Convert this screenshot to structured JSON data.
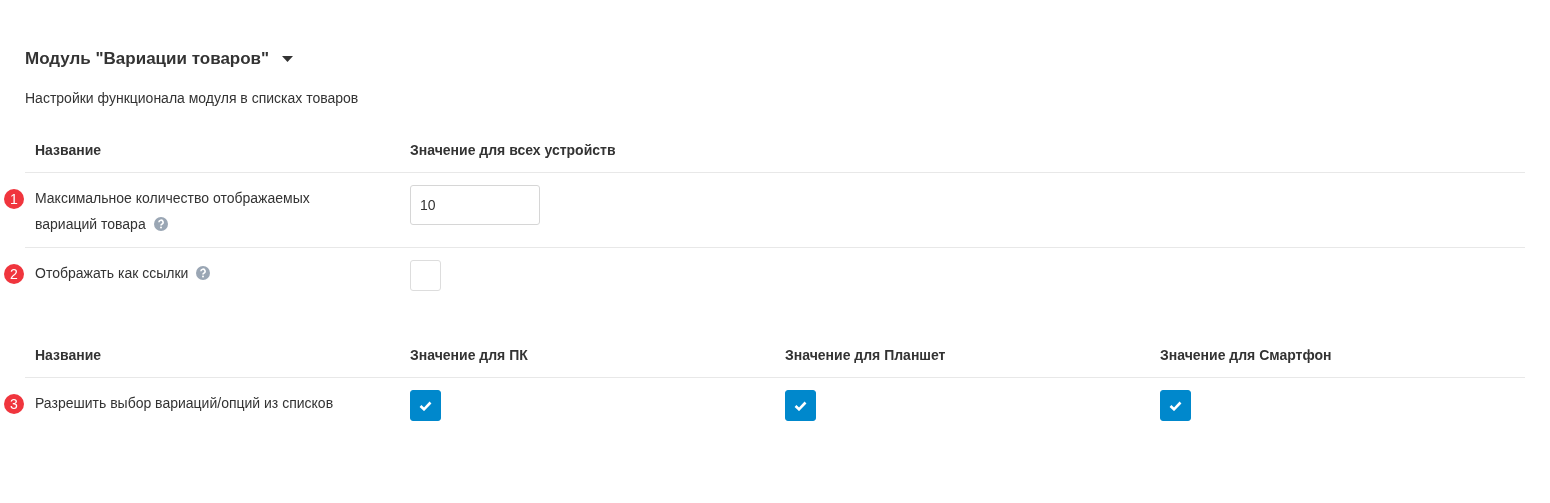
{
  "title": "Модуль \"Вариации товаров\"",
  "expanded": true,
  "subtitle": "Настройки функционала модуля в списках товаров",
  "tables": [
    {
      "columns": [
        "Название",
        "Значение для всех устройств"
      ],
      "rows": [
        {
          "cells": [
            {
              "kind": "label",
              "badge": "1",
              "text": "Максимальное количество отображаемых вариаций товара",
              "help": true
            },
            {
              "kind": "input",
              "value": "10"
            }
          ]
        },
        {
          "cells": [
            {
              "kind": "label",
              "badge": "2",
              "text": "Отображать как ссылки",
              "help": true
            },
            {
              "kind": "checkbox",
              "checked": false
            }
          ]
        }
      ]
    },
    {
      "columns": [
        "Название",
        "Значение для ПК",
        "Значение для Планшет",
        "Значение для Смартфон"
      ],
      "rows": [
        {
          "cells": [
            {
              "kind": "label",
              "badge": "3",
              "text": "Разрешить выбор вариаций/опций из списков",
              "help": false
            },
            {
              "kind": "checkbox",
              "checked": true
            },
            {
              "kind": "checkbox",
              "checked": true
            },
            {
              "kind": "checkbox",
              "checked": true
            }
          ]
        }
      ]
    }
  ]
}
